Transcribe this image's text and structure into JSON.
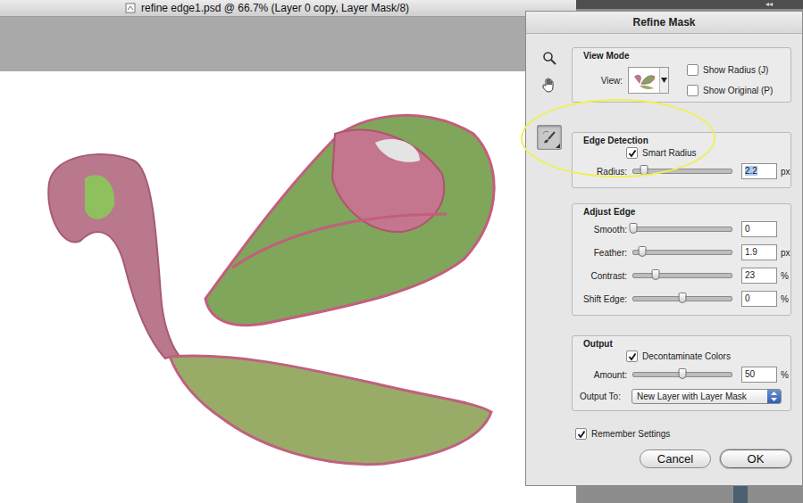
{
  "document": {
    "title": "refine edge1.psd @ 66.7% (Layer 0 copy, Layer Mask/8)"
  },
  "panel": {
    "collapse": "◂◂"
  },
  "dialog": {
    "title": "Refine Mask",
    "tools": [
      {
        "kind": "zoom",
        "selected": false
      },
      {
        "kind": "hand",
        "selected": false
      },
      {
        "kind": "refine-radius",
        "selected": true
      }
    ],
    "view_mode": {
      "heading": "View Mode",
      "view_label": "View:",
      "options": [
        {
          "label": "Show Radius (J)",
          "checked": false
        },
        {
          "label": "Show Original (P)",
          "checked": false
        }
      ]
    },
    "edge_detection": {
      "heading": "Edge Detection",
      "annotated": true,
      "smart_radius": {
        "label": "Smart Radius",
        "checked": true
      },
      "radius": {
        "label": "Radius:",
        "level": 0.11,
        "value": "2.2",
        "unit": "px",
        "value_selected": true
      }
    },
    "adjust_edge": {
      "heading": "Adjust Edge",
      "sliders": [
        {
          "label": "Smooth:",
          "level": 0,
          "value": "0"
        },
        {
          "label": "Feather:",
          "level": 0.09,
          "value": "1.9",
          "unit": "px"
        },
        {
          "label": "Contrast:",
          "level": 0.23,
          "value": "23",
          "unit": "%"
        },
        {
          "label": "Shift Edge:",
          "level": 0.5,
          "value": "0",
          "unit": "%"
        }
      ]
    },
    "output": {
      "heading": "Output",
      "decontaminate": {
        "label": "Decontaminate Colors",
        "checked": true
      },
      "amount": {
        "label": "Amount:",
        "level": 0.5,
        "value": "50",
        "unit": "%"
      },
      "output_to": {
        "label": "Output To:",
        "value": "New Layer with Layer Mask"
      }
    },
    "remember": {
      "label": "Remember Settings",
      "checked": true
    },
    "buttons": [
      {
        "label": "Cancel",
        "default": false
      },
      {
        "label": "OK",
        "default": true
      }
    ]
  }
}
